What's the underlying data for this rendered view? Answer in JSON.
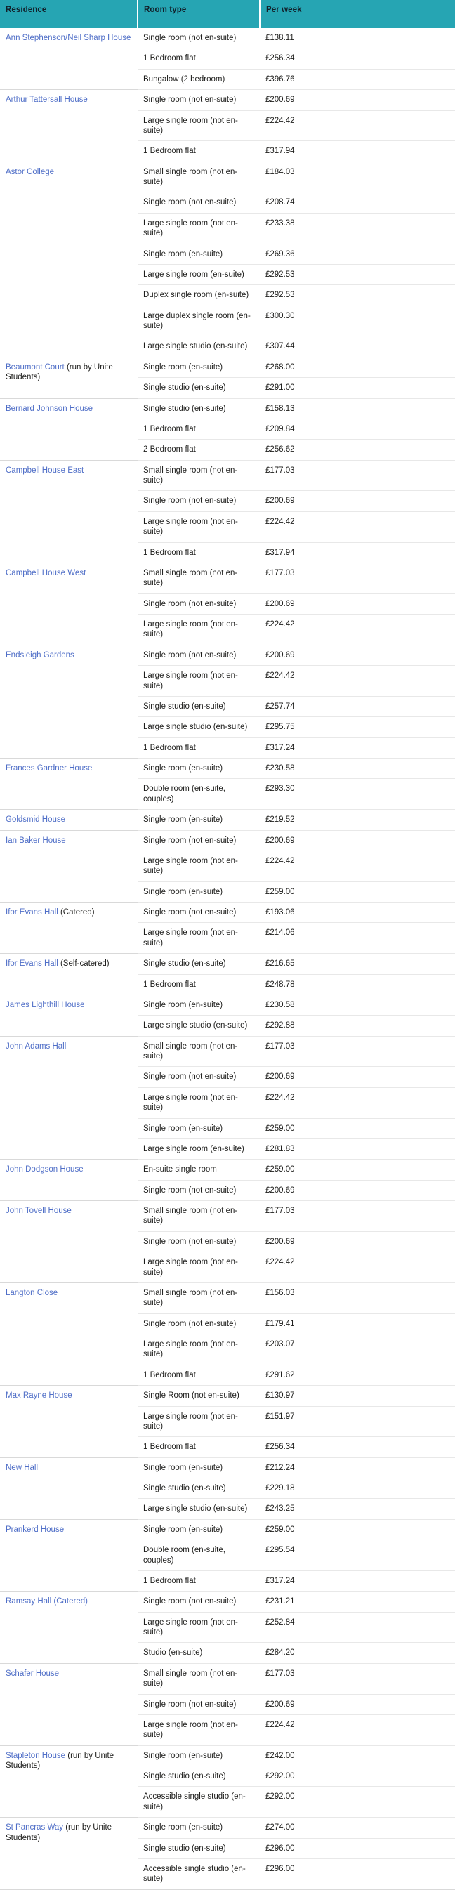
{
  "table": {
    "columns": [
      {
        "id": "residence",
        "label": "Residence"
      },
      {
        "id": "room_type",
        "label": "Room type"
      },
      {
        "id": "per_week",
        "label": "Per week"
      }
    ],
    "header_background": "#26a5b3",
    "link_color": "#4f6ec7",
    "groups": [
      {
        "residence_link": "Ann Stephenson/Neil Sharp House",
        "residence_suffix": "",
        "rows": [
          {
            "room_type": "Single room (not en-suite)",
            "per_week": "£138.11"
          },
          {
            "room_type": "1 Bedroom flat",
            "per_week": "£256.34"
          },
          {
            "room_type": "Bungalow (2 bedroom)",
            "per_week": "£396.76"
          }
        ]
      },
      {
        "residence_link": "Arthur Tattersall House",
        "residence_suffix": "",
        "rows": [
          {
            "room_type": "Single room (not en-suite)",
            "per_week": "£200.69"
          },
          {
            "room_type": "Large single room (not en-suite)",
            "per_week": "£224.42"
          },
          {
            "room_type": "1 Bedroom flat",
            "per_week": "£317.94"
          }
        ]
      },
      {
        "residence_link": "Astor College",
        "residence_suffix": "",
        "rows": [
          {
            "room_type": "Small single room (not en-suite)",
            "per_week": "£184.03"
          },
          {
            "room_type": "Single room (not en-suite)",
            "per_week": "£208.74"
          },
          {
            "room_type": "Large single room (not en-suite)",
            "per_week": "£233.38"
          },
          {
            "room_type": "Single room (en-suite)",
            "per_week": "£269.36"
          },
          {
            "room_type": "Large single room (en-suite)",
            "per_week": "£292.53"
          },
          {
            "room_type": "Duplex single room (en-suite)",
            "per_week": "£292.53"
          },
          {
            "room_type": "Large duplex single room (en-suite)",
            "per_week": "£300.30"
          },
          {
            "room_type": "Large single studio (en-suite)",
            "per_week": "£307.44"
          }
        ]
      },
      {
        "residence_link": "Beaumont Court",
        "residence_suffix": " (run by Unite Students)",
        "rows": [
          {
            "room_type": "Single room (en-suite)",
            "per_week": "£268.00"
          },
          {
            "room_type": "Single studio (en-suite)",
            "per_week": "£291.00"
          }
        ]
      },
      {
        "residence_link": "Bernard Johnson House",
        "residence_suffix": "",
        "rows": [
          {
            "room_type": "Single studio (en-suite)",
            "per_week": "£158.13"
          },
          {
            "room_type": "1 Bedroom flat",
            "per_week": "£209.84"
          },
          {
            "room_type": "2 Bedroom flat",
            "per_week": "£256.62"
          }
        ]
      },
      {
        "residence_link": "Campbell House East",
        "residence_suffix": "",
        "rows": [
          {
            "room_type": "Small single room (not en-suite)",
            "per_week": "£177.03"
          },
          {
            "room_type": "Single room (not en-suite)",
            "per_week": "£200.69"
          },
          {
            "room_type": "Large single room (not en-suite)",
            "per_week": "£224.42"
          },
          {
            "room_type": "1 Bedroom flat",
            "per_week": "£317.94"
          }
        ]
      },
      {
        "residence_link": "Campbell House West",
        "residence_suffix": "",
        "rows": [
          {
            "room_type": "Small single room (not en-suite)",
            "per_week": "£177.03"
          },
          {
            "room_type": "Single room (not en-suite)",
            "per_week": "£200.69"
          },
          {
            "room_type": "Large single room (not en-suite)",
            "per_week": "£224.42"
          }
        ]
      },
      {
        "residence_link": "Endsleigh Gardens",
        "residence_suffix": "",
        "rows": [
          {
            "room_type": "Single room (not en-suite)",
            "per_week": "£200.69"
          },
          {
            "room_type": "Large single room (not en-suite)",
            "per_week": "£224.42"
          },
          {
            "room_type": "Single studio (en-suite)",
            "per_week": "£257.74"
          },
          {
            "room_type": "Large single studio (en-suite)",
            "per_week": "£295.75"
          },
          {
            "room_type": "1 Bedroom flat",
            "per_week": "£317.24"
          }
        ]
      },
      {
        "residence_link": "Frances Gardner House",
        "residence_suffix": "",
        "rows": [
          {
            "room_type": "Single room (en-suite)",
            "per_week": "£230.58"
          },
          {
            "room_type": "Double room (en-suite, couples)",
            "per_week": "£293.30"
          }
        ]
      },
      {
        "residence_link": "Goldsmid House",
        "residence_suffix": "",
        "rows": [
          {
            "room_type": "Single room (en-suite)",
            "per_week": "£219.52"
          }
        ]
      },
      {
        "residence_link": "Ian Baker House",
        "residence_suffix": "",
        "rows": [
          {
            "room_type": "Single room (not en-suite)",
            "per_week": "£200.69"
          },
          {
            "room_type": "Large single room (not en-suite)",
            "per_week": "£224.42"
          },
          {
            "room_type": "Single room (en-suite)",
            "per_week": "£259.00"
          }
        ]
      },
      {
        "residence_link": "Ifor Evans Hall",
        "residence_suffix": " (Catered)",
        "rows": [
          {
            "room_type": "Single room (not en-suite)",
            "per_week": "£193.06"
          },
          {
            "room_type": "Large single room (not en-suite)",
            "per_week": "£214.06"
          }
        ]
      },
      {
        "residence_link": "Ifor Evans Hall",
        "residence_suffix": " (Self-catered)",
        "rows": [
          {
            "room_type": "Single studio (en-suite)",
            "per_week": "£216.65"
          },
          {
            "room_type": "1 Bedroom flat",
            "per_week": "£248.78"
          }
        ]
      },
      {
        "residence_link": "James Lighthill House",
        "residence_suffix": "",
        "rows": [
          {
            "room_type": "Single room (en-suite)",
            "per_week": "£230.58"
          },
          {
            "room_type": "Large single studio (en-suite)",
            "per_week": "£292.88"
          }
        ]
      },
      {
        "residence_link": "John Adams Hall",
        "residence_suffix": "",
        "rows": [
          {
            "room_type": "Small single room (not en-suite)",
            "per_week": "£177.03"
          },
          {
            "room_type": "Single room (not en-suite)",
            "per_week": "£200.69"
          },
          {
            "room_type": "Large single room (not en-suite)",
            "per_week": "£224.42"
          },
          {
            "room_type": "Single room (en-suite)",
            "per_week": "£259.00"
          },
          {
            "room_type": "Large single room (en-suite)",
            "per_week": "£281.83"
          }
        ]
      },
      {
        "residence_link": "John Dodgson House",
        "residence_suffix": "",
        "rows": [
          {
            "room_type": "En-suite single room",
            "per_week": "£259.00"
          },
          {
            "room_type": "Single room (not en-suite)",
            "per_week": "£200.69"
          }
        ]
      },
      {
        "residence_link": "John Tovell House",
        "residence_suffix": "",
        "rows": [
          {
            "room_type": "Small single room (not en-suite)",
            "per_week": "£177.03"
          },
          {
            "room_type": "Single room (not en-suite)",
            "per_week": "£200.69"
          },
          {
            "room_type": "Large single room (not en-suite)",
            "per_week": "£224.42"
          }
        ]
      },
      {
        "residence_link": "Langton Close",
        "residence_suffix": "",
        "rows": [
          {
            "room_type": "Small single room (not en-suite)",
            "per_week": "£156.03"
          },
          {
            "room_type": "Single room (not en-suite)",
            "per_week": "£179.41"
          },
          {
            "room_type": "Large single room (not en-suite)",
            "per_week": "£203.07"
          },
          {
            "room_type": "1 Bedroom flat",
            "per_week": "£291.62"
          }
        ]
      },
      {
        "residence_link": "Max Rayne House",
        "residence_suffix": "",
        "rows": [
          {
            "room_type": "Single Room (not en-suite)",
            "per_week": "£130.97"
          },
          {
            "room_type": "Large single room (not en-suite)",
            "per_week": "£151.97"
          },
          {
            "room_type": "1 Bedroom flat",
            "per_week": "£256.34"
          }
        ]
      },
      {
        "residence_link": "New Hall",
        "residence_suffix": "",
        "rows": [
          {
            "room_type": "Single room (en-suite)",
            "per_week": "£212.24"
          },
          {
            "room_type": "Single studio (en-suite)",
            "per_week": "£229.18"
          },
          {
            "room_type": "Large single studio (en-suite)",
            "per_week": "£243.25"
          }
        ]
      },
      {
        "residence_link": "Prankerd House",
        "residence_suffix": "",
        "rows": [
          {
            "room_type": "Single room (en-suite)",
            "per_week": "£259.00"
          },
          {
            "room_type": "Double room (en-suite, couples)",
            "per_week": "£295.54"
          },
          {
            "room_type": "1 Bedroom flat",
            "per_week": "£317.24"
          }
        ]
      },
      {
        "residence_link": "Ramsay Hall (Catered)",
        "residence_suffix": "",
        "rows": [
          {
            "room_type": "Single room (not en-suite)",
            "per_week": "£231.21"
          },
          {
            "room_type": "Large single room (not en-suite)",
            "per_week": "£252.84"
          },
          {
            "room_type": "Studio (en-suite)",
            "per_week": "£284.20"
          }
        ]
      },
      {
        "residence_link": "Schafer House",
        "residence_suffix": "",
        "rows": [
          {
            "room_type": "Small single room (not en-suite)",
            "per_week": "£177.03"
          },
          {
            "room_type": "Single room (not en-suite)",
            "per_week": "£200.69"
          },
          {
            "room_type": "Large single room (not en-suite)",
            "per_week": "£224.42"
          }
        ]
      },
      {
        "residence_link": "Stapleton House",
        "residence_suffix": " (run by Unite Students)",
        "rows": [
          {
            "room_type": "Single room (en-suite)",
            "per_week": "£242.00"
          },
          {
            "room_type": "Single studio (en-suite)",
            "per_week": "£292.00"
          },
          {
            "room_type": "Accessible single studio (en-suite)",
            "per_week": "£292.00"
          }
        ]
      },
      {
        "residence_link": "St Pancras Way",
        "residence_suffix": " (run by Unite Students)",
        "rows": [
          {
            "room_type": "Single room (en-suite)",
            "per_week": "£274.00"
          },
          {
            "room_type": "Single studio (en-suite)",
            "per_week": "£296.00"
          },
          {
            "room_type": "Accessible single studio (en-suite)",
            "per_week": "£296.00"
          }
        ]
      }
    ]
  }
}
